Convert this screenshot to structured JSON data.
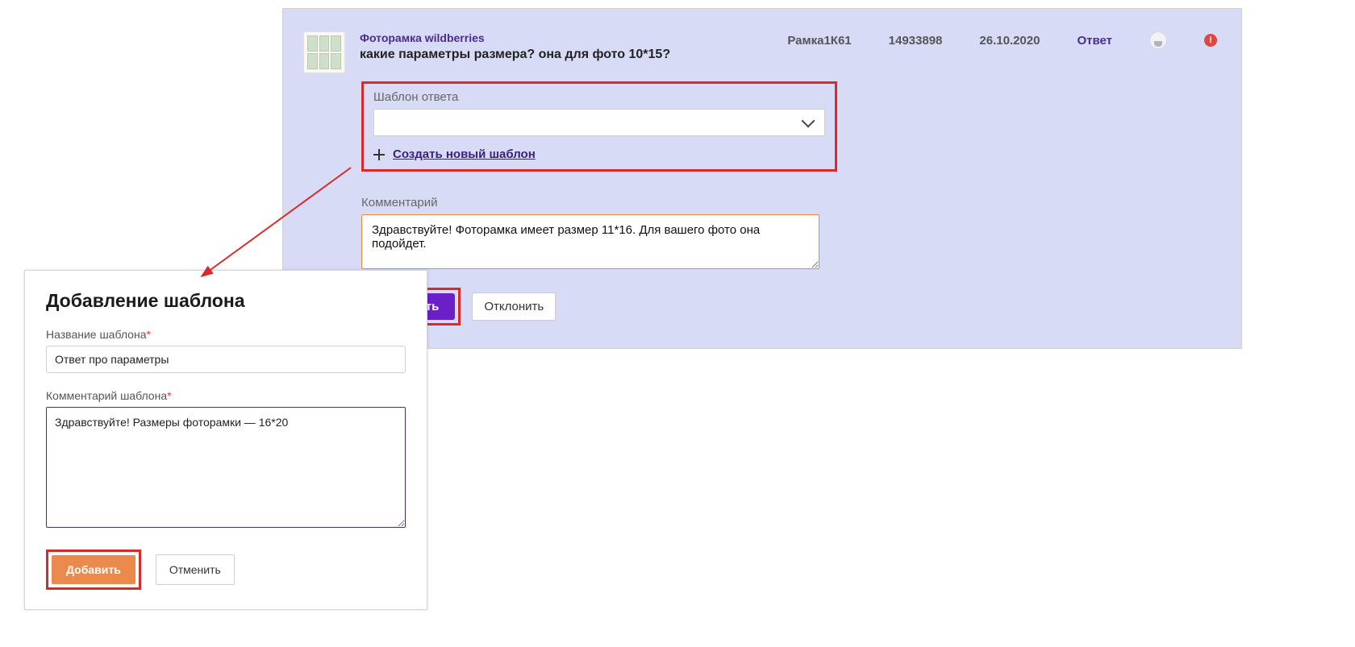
{
  "main": {
    "product_link": "Фоторамка wildberries",
    "question": "какие параметры размера? она для фото 10*15?",
    "meta": {
      "sku": "Рамка1К61",
      "code": "14933898",
      "date": "26.10.2020",
      "status": "Ответ",
      "alert": "!"
    },
    "template_label": "Шаблон ответа",
    "new_template_link": "Создать новый шаблон",
    "comment_label": "Комментарий",
    "comment_value": "Здравствуйте! Фоторамка имеет размер 11*16. Для вашего фото она подойдет.",
    "btn_answer": "Ответить",
    "btn_decline": "Отклонить"
  },
  "popup": {
    "title": "Добавление шаблона",
    "name_label": "Название шаблона",
    "name_value": "Ответ про параметры",
    "comment_label": "Комментарий шаблона",
    "comment_value": "Здравствуйте! Размеры фоторамки — 16*20",
    "btn_add": "Добавить",
    "btn_cancel": "Отменить"
  }
}
